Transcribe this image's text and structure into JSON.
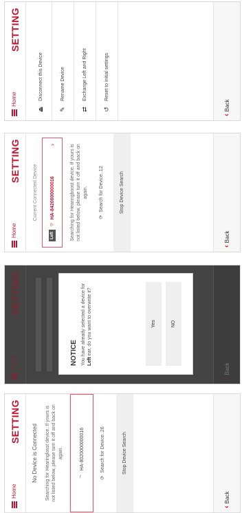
{
  "common": {
    "home_label": "Home",
    "title": "SETTING",
    "back_label": "Back",
    "colors": {
      "accent": "#c8102e",
      "frame": "#e05a6d"
    }
  },
  "panel1": {
    "status": "No Device is Connected",
    "instructions": "Searching for Hearinglosst device. If yours is not listed below, please turn it off and back on again.",
    "device": "HA-8020000000016",
    "search": "Search for Device..26",
    "stop": "Stop Device Search"
  },
  "panel2": {
    "dialog_title": "NOTICE",
    "dialog_text_a": "You have already selected a device for ",
    "dialog_text_bold": "Left",
    "dialog_text_b": " ear, do you want to overwrite it?",
    "yes": "Yes",
    "no": "NO"
  },
  "panel3": {
    "current_label": "Current Connected Device",
    "left_badge": "Left",
    "device": "HA-8420000000016",
    "instructions": "Searching for Hearingboost device. If yours is not listed below, please turn it off and back on again.",
    "search": "Search for Device..12",
    "stop": "Stop Device Search"
  },
  "panel4": {
    "items": [
      {
        "label": "Disconnect this Device",
        "icon": "eject-icon"
      },
      {
        "label": "Rename Device",
        "icon": "edit-icon"
      },
      {
        "label": "Exchange Left and Right",
        "icon": "swap-icon"
      },
      {
        "label": "Reset to initial settings",
        "icon": "reset-icon"
      }
    ]
  }
}
